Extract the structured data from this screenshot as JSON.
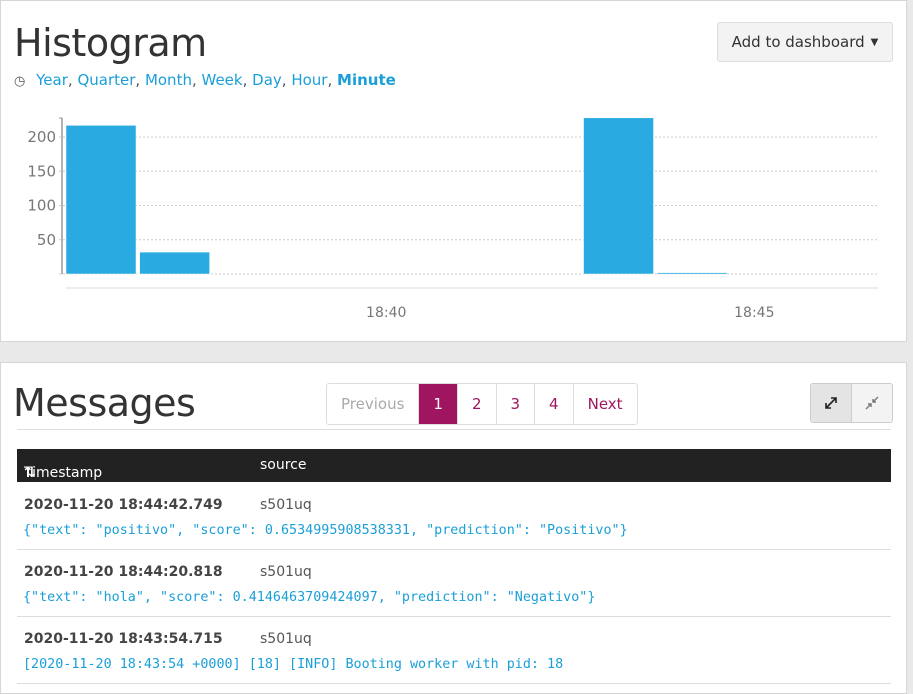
{
  "histogram": {
    "title": "Histogram",
    "ranges": [
      "Year",
      "Quarter",
      "Month",
      "Week",
      "Day",
      "Hour",
      "Minute"
    ],
    "active_range": "Minute",
    "add_button": "Add to dashboard"
  },
  "chart_data": {
    "type": "bar",
    "title": "Histogram",
    "xlabel": "",
    "ylabel": "",
    "bars": [
      {
        "start_minute": 35.65,
        "value": 217
      },
      {
        "start_minute": 36.65,
        "value": 32
      },
      {
        "start_minute": 42.68,
        "value": 228
      },
      {
        "start_minute": 43.68,
        "value": 2
      }
    ],
    "x_ticks": [
      {
        "minute": 40,
        "label": "18:40"
      },
      {
        "minute": 45,
        "label": "18:45"
      }
    ],
    "xlim": [
      35.65,
      46.68
    ],
    "y_ticks": [
      50,
      100,
      150,
      200
    ],
    "ylim": [
      0,
      230
    ],
    "color": "#29abe2",
    "grid": true
  },
  "messages": {
    "title": "Messages",
    "pager": {
      "previous": "Previous",
      "pages": [
        "1",
        "2",
        "3",
        "4"
      ],
      "current": "1",
      "next": "Next"
    },
    "columns": [
      "Timestamp",
      "source"
    ],
    "rows": [
      {
        "timestamp": "2020-11-20 18:44:42.749",
        "source": "s501uq",
        "message": "{\"text\": \"positivo\", \"score\": 0.6534995908538331, \"prediction\": \"Positivo\"}"
      },
      {
        "timestamp": "2020-11-20 18:44:20.818",
        "source": "s501uq",
        "message": "{\"text\": \"hola\", \"score\": 0.4146463709424097, \"prediction\": \"Negativo\"}"
      },
      {
        "timestamp": "2020-11-20 18:43:54.715",
        "source": "s501uq",
        "message": "[2020-11-20 18:43:54 +0000] [18] [INFO] Booting worker with pid: 18"
      }
    ]
  }
}
